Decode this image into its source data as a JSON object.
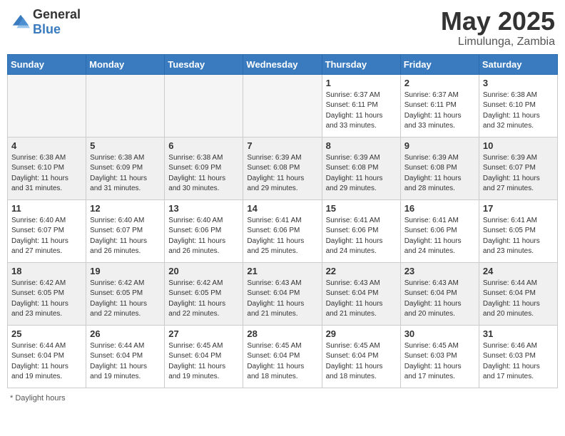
{
  "logo": {
    "general": "General",
    "blue": "Blue"
  },
  "header": {
    "month": "May 2025",
    "location": "Limulunga, Zambia"
  },
  "days_of_week": [
    "Sunday",
    "Monday",
    "Tuesday",
    "Wednesday",
    "Thursday",
    "Friday",
    "Saturday"
  ],
  "weeks": [
    [
      {
        "day": "",
        "info": ""
      },
      {
        "day": "",
        "info": ""
      },
      {
        "day": "",
        "info": ""
      },
      {
        "day": "",
        "info": ""
      },
      {
        "day": "1",
        "info": "Sunrise: 6:37 AM\nSunset: 6:11 PM\nDaylight: 11 hours and 33 minutes."
      },
      {
        "day": "2",
        "info": "Sunrise: 6:37 AM\nSunset: 6:11 PM\nDaylight: 11 hours and 33 minutes."
      },
      {
        "day": "3",
        "info": "Sunrise: 6:38 AM\nSunset: 6:10 PM\nDaylight: 11 hours and 32 minutes."
      }
    ],
    [
      {
        "day": "4",
        "info": "Sunrise: 6:38 AM\nSunset: 6:10 PM\nDaylight: 11 hours and 31 minutes."
      },
      {
        "day": "5",
        "info": "Sunrise: 6:38 AM\nSunset: 6:09 PM\nDaylight: 11 hours and 31 minutes."
      },
      {
        "day": "6",
        "info": "Sunrise: 6:38 AM\nSunset: 6:09 PM\nDaylight: 11 hours and 30 minutes."
      },
      {
        "day": "7",
        "info": "Sunrise: 6:39 AM\nSunset: 6:08 PM\nDaylight: 11 hours and 29 minutes."
      },
      {
        "day": "8",
        "info": "Sunrise: 6:39 AM\nSunset: 6:08 PM\nDaylight: 11 hours and 29 minutes."
      },
      {
        "day": "9",
        "info": "Sunrise: 6:39 AM\nSunset: 6:08 PM\nDaylight: 11 hours and 28 minutes."
      },
      {
        "day": "10",
        "info": "Sunrise: 6:39 AM\nSunset: 6:07 PM\nDaylight: 11 hours and 27 minutes."
      }
    ],
    [
      {
        "day": "11",
        "info": "Sunrise: 6:40 AM\nSunset: 6:07 PM\nDaylight: 11 hours and 27 minutes."
      },
      {
        "day": "12",
        "info": "Sunrise: 6:40 AM\nSunset: 6:07 PM\nDaylight: 11 hours and 26 minutes."
      },
      {
        "day": "13",
        "info": "Sunrise: 6:40 AM\nSunset: 6:06 PM\nDaylight: 11 hours and 26 minutes."
      },
      {
        "day": "14",
        "info": "Sunrise: 6:41 AM\nSunset: 6:06 PM\nDaylight: 11 hours and 25 minutes."
      },
      {
        "day": "15",
        "info": "Sunrise: 6:41 AM\nSunset: 6:06 PM\nDaylight: 11 hours and 24 minutes."
      },
      {
        "day": "16",
        "info": "Sunrise: 6:41 AM\nSunset: 6:06 PM\nDaylight: 11 hours and 24 minutes."
      },
      {
        "day": "17",
        "info": "Sunrise: 6:41 AM\nSunset: 6:05 PM\nDaylight: 11 hours and 23 minutes."
      }
    ],
    [
      {
        "day": "18",
        "info": "Sunrise: 6:42 AM\nSunset: 6:05 PM\nDaylight: 11 hours and 23 minutes."
      },
      {
        "day": "19",
        "info": "Sunrise: 6:42 AM\nSunset: 6:05 PM\nDaylight: 11 hours and 22 minutes."
      },
      {
        "day": "20",
        "info": "Sunrise: 6:42 AM\nSunset: 6:05 PM\nDaylight: 11 hours and 22 minutes."
      },
      {
        "day": "21",
        "info": "Sunrise: 6:43 AM\nSunset: 6:04 PM\nDaylight: 11 hours and 21 minutes."
      },
      {
        "day": "22",
        "info": "Sunrise: 6:43 AM\nSunset: 6:04 PM\nDaylight: 11 hours and 21 minutes."
      },
      {
        "day": "23",
        "info": "Sunrise: 6:43 AM\nSunset: 6:04 PM\nDaylight: 11 hours and 20 minutes."
      },
      {
        "day": "24",
        "info": "Sunrise: 6:44 AM\nSunset: 6:04 PM\nDaylight: 11 hours and 20 minutes."
      }
    ],
    [
      {
        "day": "25",
        "info": "Sunrise: 6:44 AM\nSunset: 6:04 PM\nDaylight: 11 hours and 19 minutes."
      },
      {
        "day": "26",
        "info": "Sunrise: 6:44 AM\nSunset: 6:04 PM\nDaylight: 11 hours and 19 minutes."
      },
      {
        "day": "27",
        "info": "Sunrise: 6:45 AM\nSunset: 6:04 PM\nDaylight: 11 hours and 19 minutes."
      },
      {
        "day": "28",
        "info": "Sunrise: 6:45 AM\nSunset: 6:04 PM\nDaylight: 11 hours and 18 minutes."
      },
      {
        "day": "29",
        "info": "Sunrise: 6:45 AM\nSunset: 6:04 PM\nDaylight: 11 hours and 18 minutes."
      },
      {
        "day": "30",
        "info": "Sunrise: 6:45 AM\nSunset: 6:03 PM\nDaylight: 11 hours and 17 minutes."
      },
      {
        "day": "31",
        "info": "Sunrise: 6:46 AM\nSunset: 6:03 PM\nDaylight: 11 hours and 17 minutes."
      }
    ]
  ],
  "footer": {
    "daylight_hours_label": "Daylight hours"
  }
}
